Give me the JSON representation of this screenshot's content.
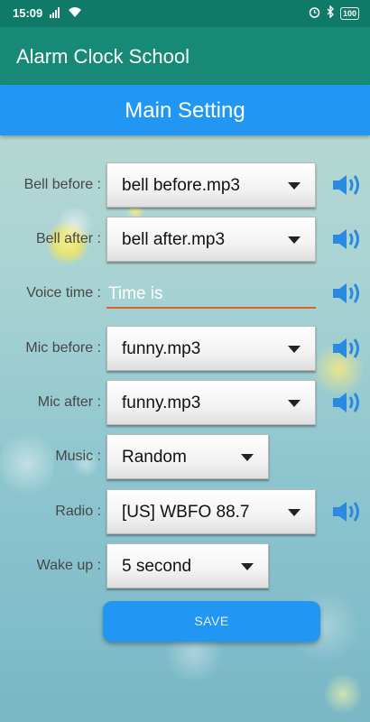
{
  "status_bar": {
    "time": "15:09",
    "battery": "100"
  },
  "app_bar": {
    "title": "Alarm Clock School"
  },
  "section": {
    "title": "Main Setting"
  },
  "settings": {
    "bell_before": {
      "label": "Bell before :",
      "value": "bell before.mp3"
    },
    "bell_after": {
      "label": "Bell after :",
      "value": "bell after.mp3"
    },
    "voice_time": {
      "label": "Voice time :",
      "value": "Time is"
    },
    "mic_before": {
      "label": "Mic before :",
      "value": "funny.mp3"
    },
    "mic_after": {
      "label": "Mic after :",
      "value": "funny.mp3"
    },
    "music": {
      "label": "Music :",
      "value": "Random"
    },
    "radio": {
      "label": "Radio :",
      "value": "[US] WBFO 88.7"
    },
    "wake_up": {
      "label": "Wake up :",
      "value": "5 second"
    }
  },
  "save_button": {
    "label": "SAVE"
  },
  "colors": {
    "status_bar": "#0f7a68",
    "app_bar": "#168a76",
    "section_bar": "#2196f3",
    "save_button": "#2196f3",
    "input_underline": "#e0602a",
    "speaker_icon": "#2a8ae0"
  },
  "icons": {
    "speaker": "speaker-volume-icon",
    "dropdown": "caret-down-icon"
  }
}
